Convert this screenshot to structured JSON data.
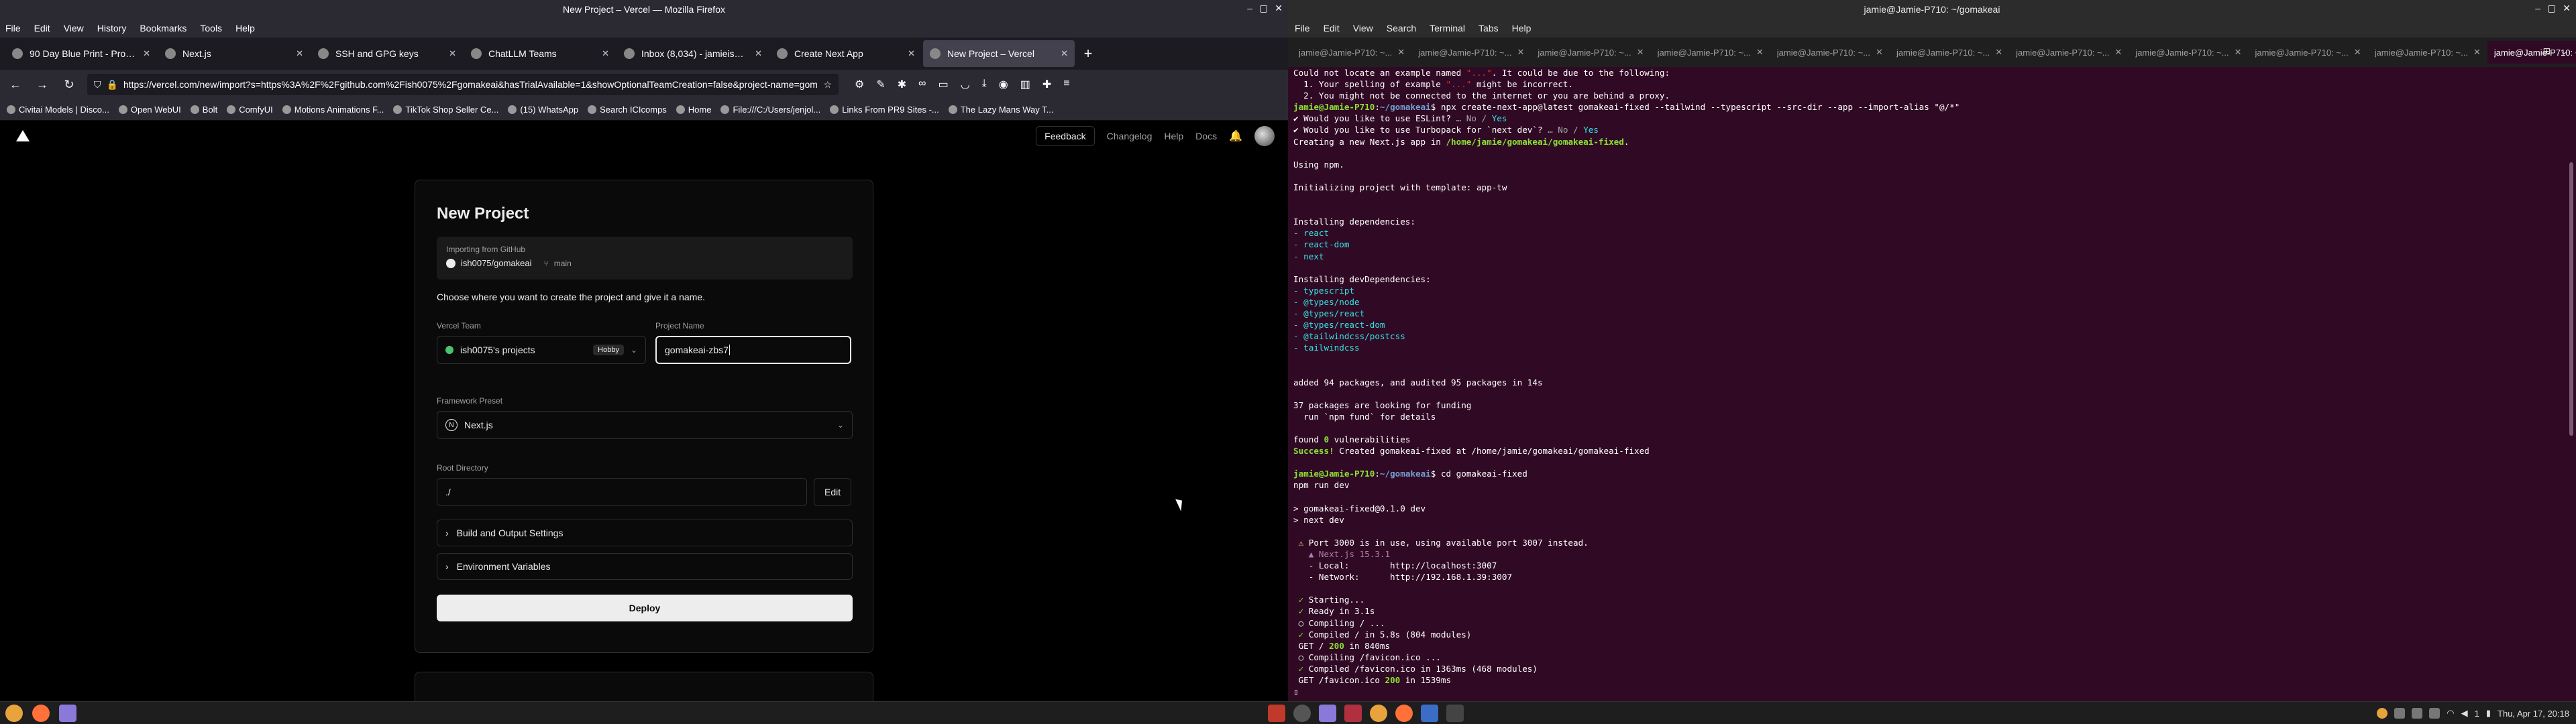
{
  "firefox": {
    "window_title": "New Project – Vercel — Mozilla Firefox",
    "menu": [
      "File",
      "Edit",
      "View",
      "History",
      "Bookmarks",
      "Tools",
      "Help"
    ],
    "tabs": [
      {
        "label": "90 Day Blue Print - Project | G",
        "active": false
      },
      {
        "label": "Next.js",
        "active": false
      },
      {
        "label": "SSH and GPG keys",
        "active": false
      },
      {
        "label": "ChatLLM Teams",
        "active": false
      },
      {
        "label": "Inbox (8,034) - jamieisherw",
        "active": false
      },
      {
        "label": "Create Next App",
        "active": false
      },
      {
        "label": "New Project – Vercel",
        "active": true
      }
    ],
    "url": "https://vercel.com/new/import?s=https%3A%2F%2Fgithub.com%2Fish0075%2Fgomakeai&hasTrialAvailable=1&showOptionalTeamCreation=false&project-name=gomak",
    "bookmarks": [
      "Civitai Models | Disco...",
      "Open WebUI",
      "Bolt",
      "ComfyUI",
      "Motions Animations F...",
      "TikTok Shop Seller Ce...",
      "(15) WhatsApp",
      "Search ICIcomps",
      "Home",
      "File:///C:/Users/jenjol...",
      "Links From PR9 Sites -...",
      "The Lazy Mans Way T..."
    ]
  },
  "vercel": {
    "feedback": "Feedback",
    "nav": [
      "Changelog",
      "Help",
      "Docs"
    ],
    "title": "New Project",
    "importing_label": "Importing from GitHub",
    "repo": "ish0075/gomakeai",
    "branch": "main",
    "choose_text": "Choose where you want to create the project and give it a name.",
    "team_label": "Vercel Team",
    "team_value": "ish0075's projects",
    "team_badge": "Hobby",
    "name_label": "Project Name",
    "name_value": "gomakeai-zbs7",
    "framework_label": "Framework Preset",
    "framework_value": "Next.js",
    "root_label": "Root Directory",
    "root_value": "./",
    "edit_label": "Edit",
    "accordions": [
      "Build and Output Settings",
      "Environment Variables"
    ],
    "deploy": "Deploy"
  },
  "terminal": {
    "window_title": "jamie@Jamie-P710: ~/gomakeai",
    "menu": [
      "File",
      "Edit",
      "View",
      "Search",
      "Terminal",
      "Tabs",
      "Help"
    ],
    "tabs": [
      "jamie@Jamie-P710: ~...",
      "jamie@Jamie-P710: ~...",
      "jamie@Jamie-P710: ~...",
      "jamie@Jamie-P710: ~...",
      "jamie@Jamie-P710: ~...",
      "jamie@Jamie-P710: ~...",
      "jamie@Jamie-P710: ~...",
      "jamie@Jamie-P710: ~...",
      "jamie@Jamie-P710: ~...",
      "jamie@Jamie-P710: ~...",
      "jamie@Jamie-P710: ~..."
    ],
    "lines": [
      [
        {
          "t": "Could not locate an example named "
        },
        {
          "t": "\"...\"",
          "c": "c-red"
        },
        {
          "t": ". It could be due to the following:"
        }
      ],
      [
        {
          "t": "  1. Your spelling of example "
        },
        {
          "t": "\"...\"",
          "c": "c-red"
        },
        {
          "t": " might be incorrect."
        }
      ],
      [
        {
          "t": "  2. You might not be connected to the internet or you are behind a proxy."
        }
      ],
      [
        {
          "t": "jamie@Jamie-P710",
          "c": "c-green"
        },
        {
          "t": ":"
        },
        {
          "t": "~/gomakeai",
          "c": "c-blue"
        },
        {
          "t": "$ npx create-next-app@latest gomakeai-fixed --tailwind --typescript --src-dir --app --import-alias \"@/*\""
        }
      ],
      [
        {
          "t": "✔ Would you like to use ESLint? ",
          "c": ""
        },
        {
          "t": "… No / ",
          "c": "c-dim"
        },
        {
          "t": "Yes",
          "c": "c-cyan"
        }
      ],
      [
        {
          "t": "✔ Would you like to use Turbopack for `next dev`? ",
          "c": ""
        },
        {
          "t": "… No / ",
          "c": "c-dim"
        },
        {
          "t": "Yes",
          "c": "c-cyan"
        }
      ],
      [
        {
          "t": "Creating a new Next.js app in "
        },
        {
          "t": "/home/jamie/gomakeai/gomakeai-fixed",
          "c": "c-green"
        },
        {
          "t": "."
        }
      ],
      [
        {
          "t": ""
        }
      ],
      [
        {
          "t": "Using npm."
        }
      ],
      [
        {
          "t": ""
        }
      ],
      [
        {
          "t": "Initializing project with template: app-tw"
        }
      ],
      [
        {
          "t": ""
        }
      ],
      [
        {
          "t": ""
        }
      ],
      [
        {
          "t": "Installing dependencies:"
        }
      ],
      [
        {
          "t": "- react",
          "c": "c-cyan"
        }
      ],
      [
        {
          "t": "- react-dom",
          "c": "c-cyan"
        }
      ],
      [
        {
          "t": "- next",
          "c": "c-cyan"
        }
      ],
      [
        {
          "t": ""
        }
      ],
      [
        {
          "t": "Installing devDependencies:"
        }
      ],
      [
        {
          "t": "- typescript",
          "c": "c-cyan"
        }
      ],
      [
        {
          "t": "- @types/node",
          "c": "c-cyan"
        }
      ],
      [
        {
          "t": "- @types/react",
          "c": "c-cyan"
        }
      ],
      [
        {
          "t": "- @types/react-dom",
          "c": "c-cyan"
        }
      ],
      [
        {
          "t": "- @tailwindcss/postcss",
          "c": "c-cyan"
        }
      ],
      [
        {
          "t": "- tailwindcss",
          "c": "c-cyan"
        }
      ],
      [
        {
          "t": ""
        }
      ],
      [
        {
          "t": ""
        }
      ],
      [
        {
          "t": "added 94 packages, and audited 95 packages in 14s"
        }
      ],
      [
        {
          "t": ""
        }
      ],
      [
        {
          "t": "37 packages are looking for funding"
        }
      ],
      [
        {
          "t": "  run `npm fund` for details"
        }
      ],
      [
        {
          "t": ""
        }
      ],
      [
        {
          "t": "found "
        },
        {
          "t": "0",
          "c": "c-green"
        },
        {
          "t": " vulnerabilities"
        }
      ],
      [
        {
          "t": "Success!",
          "c": "c-green"
        },
        {
          "t": " Created gomakeai-fixed at /home/jamie/gomakeai/gomakeai-fixed"
        }
      ],
      [
        {
          "t": ""
        }
      ],
      [
        {
          "t": "jamie@Jamie-P710",
          "c": "c-green"
        },
        {
          "t": ":"
        },
        {
          "t": "~/gomakeai",
          "c": "c-blue"
        },
        {
          "t": "$ cd gomakeai-fixed"
        }
      ],
      [
        {
          "t": "npm run dev"
        }
      ],
      [
        {
          "t": ""
        }
      ],
      [
        {
          "t": "> gomakeai-fixed@0.1.0 dev"
        }
      ],
      [
        {
          "t": "> next dev"
        }
      ],
      [
        {
          "t": ""
        }
      ],
      [
        {
          "t": " ⚠ ",
          "c": "c-yellow"
        },
        {
          "t": "Port 3000 is in use, using available port 3007 instead."
        }
      ],
      [
        {
          "t": "   ▲ Next.js 15.3.1",
          "c": "c-magenta"
        }
      ],
      [
        {
          "t": "   - Local:        http://localhost:3007"
        }
      ],
      [
        {
          "t": "   - Network:      http://192.168.1.39:3007"
        }
      ],
      [
        {
          "t": ""
        }
      ],
      [
        {
          "t": " ✓ ",
          "c": "c-green"
        },
        {
          "t": "Starting..."
        }
      ],
      [
        {
          "t": " ✓ ",
          "c": "c-green"
        },
        {
          "t": "Ready in 3.1s"
        }
      ],
      [
        {
          "t": " ○ Compiling / ..."
        }
      ],
      [
        {
          "t": " ✓ ",
          "c": "c-green"
        },
        {
          "t": "Compiled / in 5.8s (804 modules)"
        }
      ],
      [
        {
          "t": " GET / "
        },
        {
          "t": "200",
          "c": "c-green"
        },
        {
          "t": " in 840ms"
        }
      ],
      [
        {
          "t": " ○ Compiling /favicon.ico ..."
        }
      ],
      [
        {
          "t": " ✓ ",
          "c": "c-green"
        },
        {
          "t": "Compiled /favicon.ico in 1363ms (468 modules)"
        }
      ],
      [
        {
          "t": " GET /favicon.ico "
        },
        {
          "t": "200",
          "c": "c-green"
        },
        {
          "t": " in 1539ms"
        }
      ],
      [
        {
          "t": "▯"
        }
      ]
    ]
  },
  "taskbar": {
    "clock": "Thu, Apr 17, 20:18",
    "badge": "1"
  }
}
